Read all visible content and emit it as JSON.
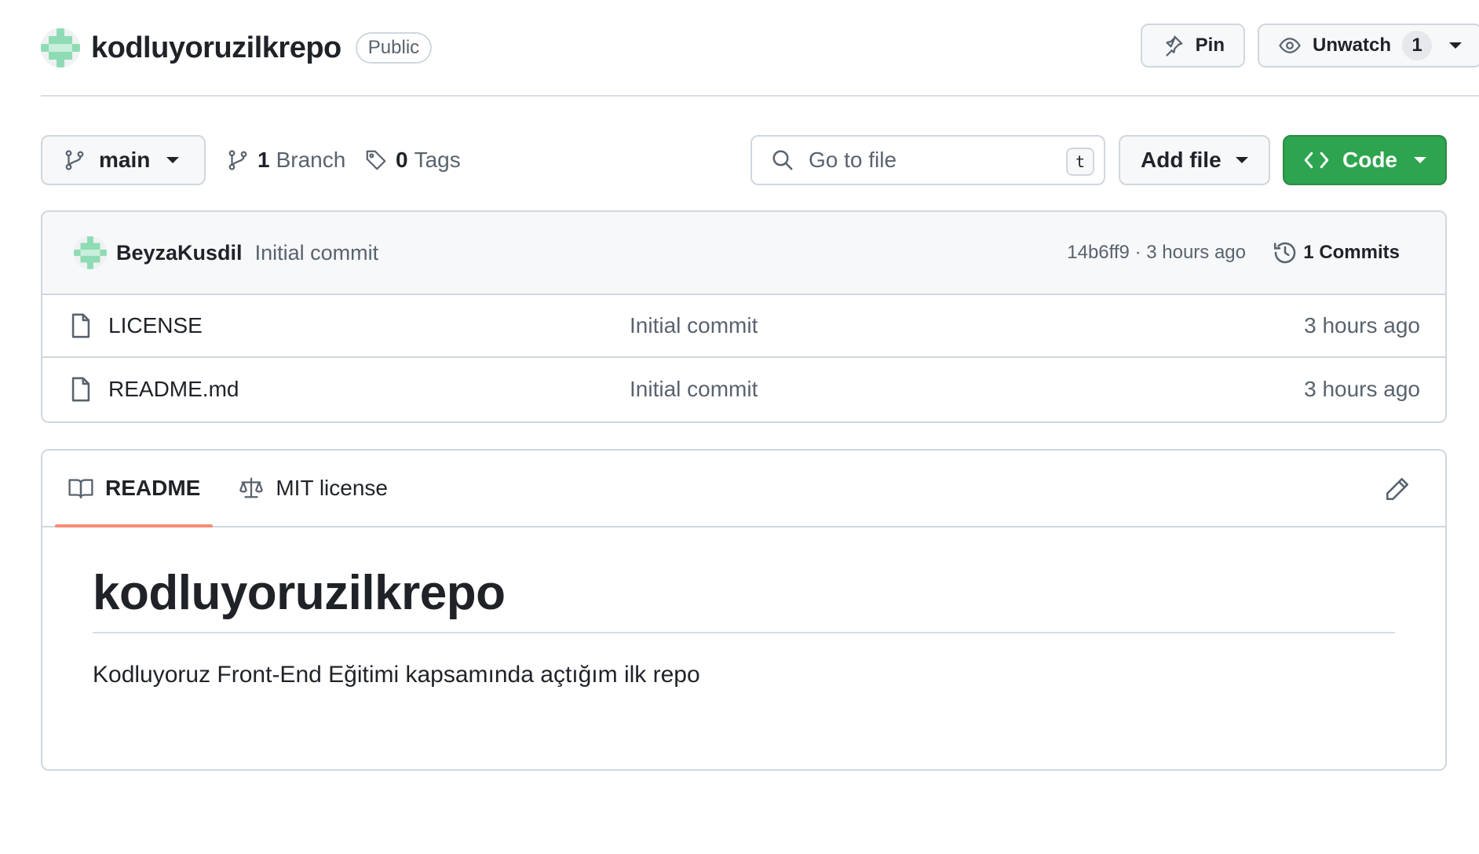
{
  "repo": {
    "name": "kodluyoruzilkrepo",
    "visibility": "Public"
  },
  "header": {
    "pin_label": "Pin",
    "unwatch_label": "Unwatch",
    "watch_count": "1"
  },
  "toolbar": {
    "branch_name": "main",
    "branch_count": "1",
    "branch_label": "Branch",
    "tag_count": "0",
    "tag_label": "Tags",
    "search_placeholder": "Go to file",
    "search_shortcut": "t",
    "add_file_label": "Add file",
    "code_label": "Code"
  },
  "latest_commit": {
    "author": "BeyzaKusdil",
    "message": "Initial commit",
    "sha_time": "14b6ff9 · 3 hours ago",
    "commits_label": "1 Commits"
  },
  "files": [
    {
      "name": "LICENSE",
      "commit": "Initial commit",
      "time": "3 hours ago"
    },
    {
      "name": "README.md",
      "commit": "Initial commit",
      "time": "3 hours ago"
    }
  ],
  "readme": {
    "tab_readme": "README",
    "tab_license": "MIT license",
    "title": "kodluyoruzilkrepo",
    "text": "Kodluyoruz Front-End Eğitimi kapsamında açtığım ilk repo"
  },
  "colors": {
    "primary_button": "#2da44e",
    "active_tab_underline": "#fd8c73",
    "avatar": "#8fdcb4"
  },
  "icons": [
    "repo-avatar",
    "pin-icon",
    "eye-icon",
    "git-branch-icon",
    "tag-icon",
    "search-icon",
    "code-icon",
    "history-icon",
    "file-icon",
    "book-icon",
    "law-icon",
    "pencil-icon"
  ]
}
